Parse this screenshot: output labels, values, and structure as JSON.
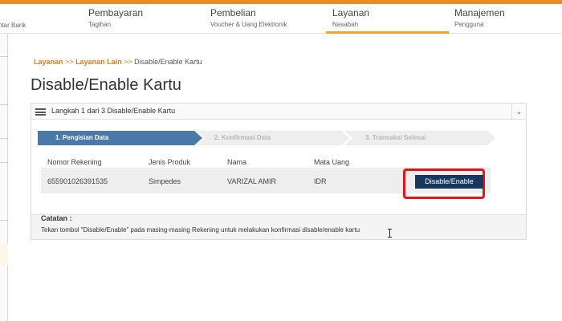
{
  "nav": {
    "items": [
      {
        "title": "",
        "sub": "ntar Bank"
      },
      {
        "title": "Pembayaran",
        "sub": "Tagihan"
      },
      {
        "title": "Pembelian",
        "sub": "Voucher & Uang Elektronik"
      },
      {
        "title": "Layanan",
        "sub": "Nasabah"
      },
      {
        "title": "Manajemen",
        "sub": "Pengguna"
      }
    ]
  },
  "breadcrumb": {
    "item1": "Layanan",
    "sep1": ">>",
    "item2": "Layanan Lain",
    "sep2": ">>",
    "current": "Disable/Enable Kartu"
  },
  "page": {
    "title": "Disable/Enable Kartu"
  },
  "panel": {
    "header": "Langkah 1 dari 3 Disable/Enable Kartu",
    "chevron": "⌄"
  },
  "steps": [
    "1. Pengisian Data",
    "2. Konfirmasi Data",
    "3. Transaksi Selesai"
  ],
  "table": {
    "headers": [
      "Nomor Rekening",
      "Jenis Produk",
      "Nama",
      "Mata Uang"
    ],
    "rows": [
      {
        "account": "655901026391535",
        "product": "Simpedes",
        "name": "VARIZAL AMIR",
        "currency": "IDR",
        "action": "Disable/Enable"
      }
    ]
  },
  "notes": {
    "title": "Catatan :",
    "text": "Tekan tombol \"Disable/Enable\" pada masing-masing Rekening untuk melakukan konfirmasi disable/enable kartu"
  },
  "colors": {
    "accent": "#f08a24",
    "step_active": "#4a78a8",
    "button": "#16375e",
    "highlight": "#e0161b"
  }
}
